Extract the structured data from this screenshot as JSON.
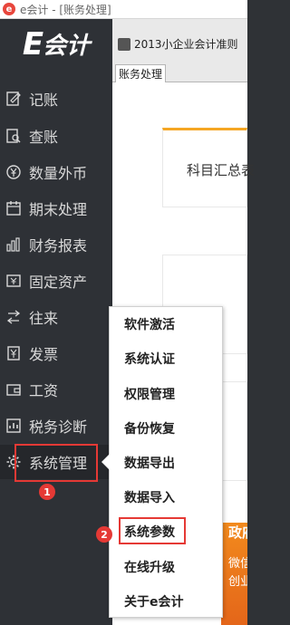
{
  "window": {
    "title": "e会计 - [账务处理]",
    "app_icon": "e-icon"
  },
  "logo": {
    "e": "E",
    "rest": "会计"
  },
  "sidebar": {
    "items": [
      {
        "label": "记账",
        "icon": "pencil-note-icon"
      },
      {
        "label": "查账",
        "icon": "search-document-icon"
      },
      {
        "label": "数量外币",
        "icon": "yen-coin-icon"
      },
      {
        "label": "期末处理",
        "icon": "calendar-icon"
      },
      {
        "label": "财务报表",
        "icon": "bar-chart-icon"
      },
      {
        "label": "固定资产",
        "icon": "asset-icon"
      },
      {
        "label": "往来",
        "icon": "transfer-icon"
      },
      {
        "label": "发票",
        "icon": "invoice-yen-icon"
      },
      {
        "label": "工资",
        "icon": "wallet-icon"
      },
      {
        "label": "税务诊断",
        "icon": "tax-chart-icon"
      },
      {
        "label": "系统管理",
        "icon": "gear-icon"
      }
    ]
  },
  "badges": {
    "step1": "1",
    "step2": "2"
  },
  "toolbar": {
    "standard_label": "2013小企业会计准则"
  },
  "tabs": [
    {
      "label": "账务处理"
    }
  ],
  "main": {
    "card_title": "科目汇总表"
  },
  "banner": {
    "line1": "政府",
    "line2": "微信",
    "line3": "创业"
  },
  "popup_menu": {
    "items": [
      {
        "label": "软件激活"
      },
      {
        "label": "系统认证"
      },
      {
        "label": "权限管理"
      },
      {
        "label": "备份恢复"
      },
      {
        "label": "数据导出"
      },
      {
        "label": "数据导入"
      },
      {
        "label": "系统参数"
      },
      {
        "label": "在线升级"
      },
      {
        "label": "关于e会计"
      }
    ]
  },
  "colors": {
    "sidebar_bg": "#2e3136",
    "highlight": "#e53935",
    "accent": "#f5a623"
  }
}
